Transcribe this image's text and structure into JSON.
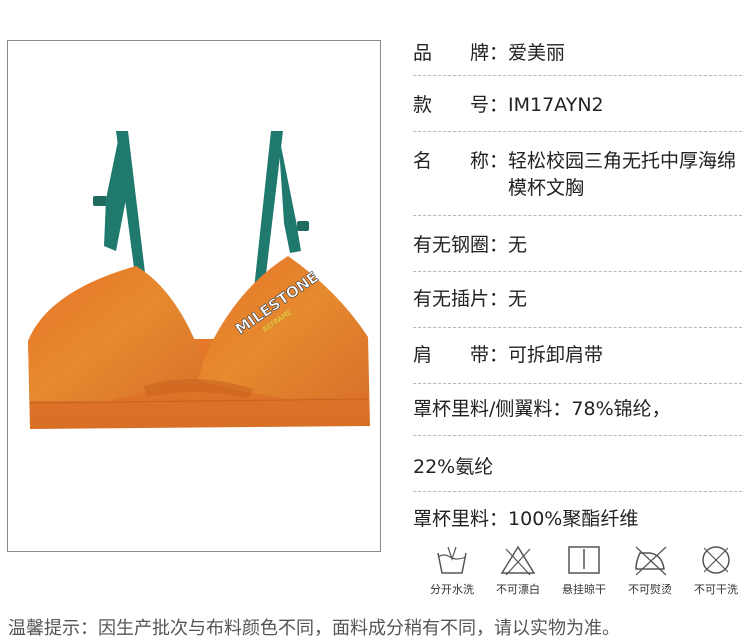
{
  "product_image": {
    "logo_text": "MILESTONE",
    "logo_subtext": "REFRAME",
    "strap_color": "#1f7a6d",
    "body_color": "#e8792a"
  },
  "specs": [
    {
      "label": "品　　牌：",
      "value": "爱美丽"
    },
    {
      "label": "款　　号：",
      "value": "IM17AYN2"
    },
    {
      "label": "名　　称：",
      "value": "轻松校园三角无托中厚海绵模杯文胸"
    },
    {
      "label": "有无钢圈：",
      "value": "无"
    },
    {
      "label": "有无插片：",
      "value": "无"
    },
    {
      "label": "肩　　带：",
      "value": "可拆卸肩带"
    },
    {
      "label": "罩杯里料/侧翼料：",
      "value": "78%锦纶，"
    },
    {
      "label": "",
      "value": "22%氨纶"
    },
    {
      "label": "罩杯里料：",
      "value": "100%聚酯纤维"
    }
  ],
  "care_icons": [
    {
      "icon": "hand-wash-icon",
      "label": "分开水洗"
    },
    {
      "icon": "no-bleach-icon",
      "label": "不可漂白"
    },
    {
      "icon": "hang-dry-icon",
      "label": "悬挂晾干"
    },
    {
      "icon": "no-iron-icon",
      "label": "不可熨烫"
    },
    {
      "icon": "no-dry-clean-icon",
      "label": "不可干洗"
    }
  ],
  "notice": "温馨提示：因生产批次与布料颜色不同，面料成分稍有不同，请以实物为准。"
}
